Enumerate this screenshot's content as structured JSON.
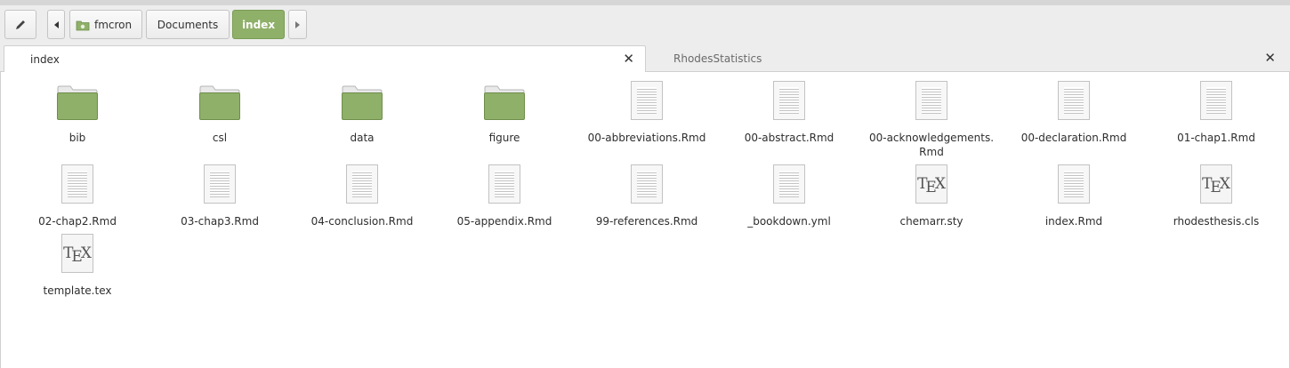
{
  "toolbar": {
    "breadcrumbs": [
      "fmcron",
      "Documents",
      "index"
    ]
  },
  "tabs": [
    {
      "label": "index",
      "active": true
    },
    {
      "label": "RhodesStatistics",
      "active": false
    }
  ],
  "files": [
    {
      "name": "bib",
      "type": "folder"
    },
    {
      "name": "csl",
      "type": "folder"
    },
    {
      "name": "data",
      "type": "folder"
    },
    {
      "name": "figure",
      "type": "folder"
    },
    {
      "name": "00-abbreviations.Rmd",
      "type": "text"
    },
    {
      "name": "00-abstract.Rmd",
      "type": "text"
    },
    {
      "name": "00-acknowledgements.Rmd",
      "type": "text"
    },
    {
      "name": "00-declaration.Rmd",
      "type": "text"
    },
    {
      "name": "01-chap1.Rmd",
      "type": "text"
    },
    {
      "name": "02-chap2.Rmd",
      "type": "text"
    },
    {
      "name": "03-chap3.Rmd",
      "type": "text"
    },
    {
      "name": "04-conclusion.Rmd",
      "type": "text"
    },
    {
      "name": "05-appendix.Rmd",
      "type": "text"
    },
    {
      "name": "99-references.Rmd",
      "type": "text"
    },
    {
      "name": "_bookdown.yml",
      "type": "text"
    },
    {
      "name": "chemarr.sty",
      "type": "tex"
    },
    {
      "name": "index.Rmd",
      "type": "text"
    },
    {
      "name": "rhodesthesis.cls",
      "type": "tex"
    },
    {
      "name": "template.tex",
      "type": "tex"
    }
  ],
  "colors": {
    "folder": "#8fb069",
    "accent": "#8fb069"
  }
}
